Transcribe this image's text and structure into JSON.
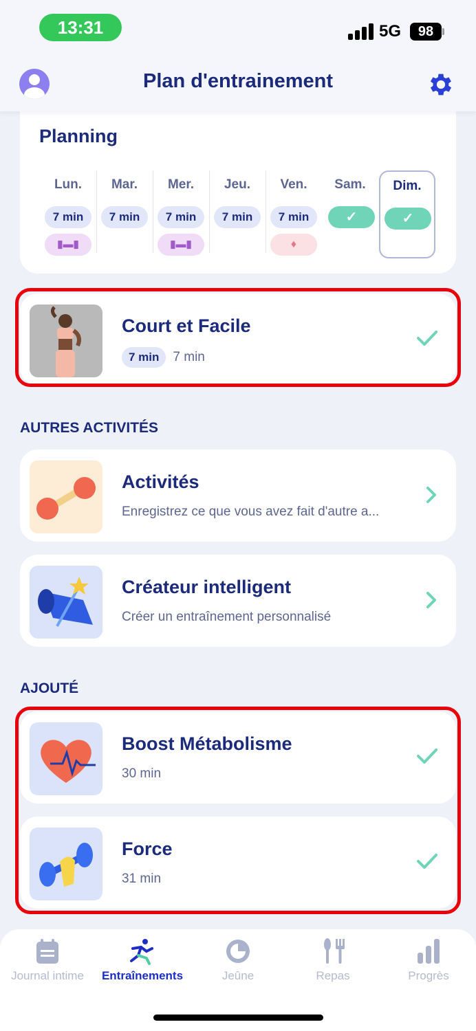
{
  "status_bar": {
    "time": "13:31",
    "network": "5G",
    "battery": "98"
  },
  "header": {
    "title": "Plan d'entrainement"
  },
  "planning": {
    "title": "Planning",
    "days": [
      {
        "label": "Lun.",
        "status": "7 min",
        "activity": "dumbbell"
      },
      {
        "label": "Mar.",
        "status": "7 min",
        "activity": ""
      },
      {
        "label": "Mer.",
        "status": "7 min",
        "activity": "dumbbell"
      },
      {
        "label": "Jeu.",
        "status": "7 min",
        "activity": ""
      },
      {
        "label": "Ven.",
        "status": "7 min",
        "activity": "fire"
      },
      {
        "label": "Sam.",
        "status": "done",
        "activity": ""
      },
      {
        "label": "Dim.",
        "status": "done",
        "activity": ""
      }
    ]
  },
  "workout": {
    "title": "Court et Facile",
    "chip": "7 min",
    "duration": "7 min"
  },
  "other_activities": {
    "section_title": "AUTRES ACTIVITÉS",
    "items": [
      {
        "title": "Activités",
        "subtitle": "Enregistrez ce que vous avez fait d'autre a..."
      },
      {
        "title": "Créateur intelligent",
        "subtitle": "Créer un entraînement personnalisé"
      }
    ]
  },
  "added": {
    "section_title": "AJOUTÉ",
    "items": [
      {
        "title": "Boost Métabolisme",
        "duration": "30 min"
      },
      {
        "title": "Force",
        "duration": "31 min"
      }
    ]
  },
  "nav": {
    "items": [
      {
        "label": "Journal intime"
      },
      {
        "label": "Entraînements"
      },
      {
        "label": "Jeûne"
      },
      {
        "label": "Repas"
      },
      {
        "label": "Progrès"
      }
    ]
  },
  "colors": {
    "accent": "#1b2a7a",
    "active_nav": "#1d2ec6",
    "check": "#6fd4b8",
    "highlight": "#e8000b"
  }
}
